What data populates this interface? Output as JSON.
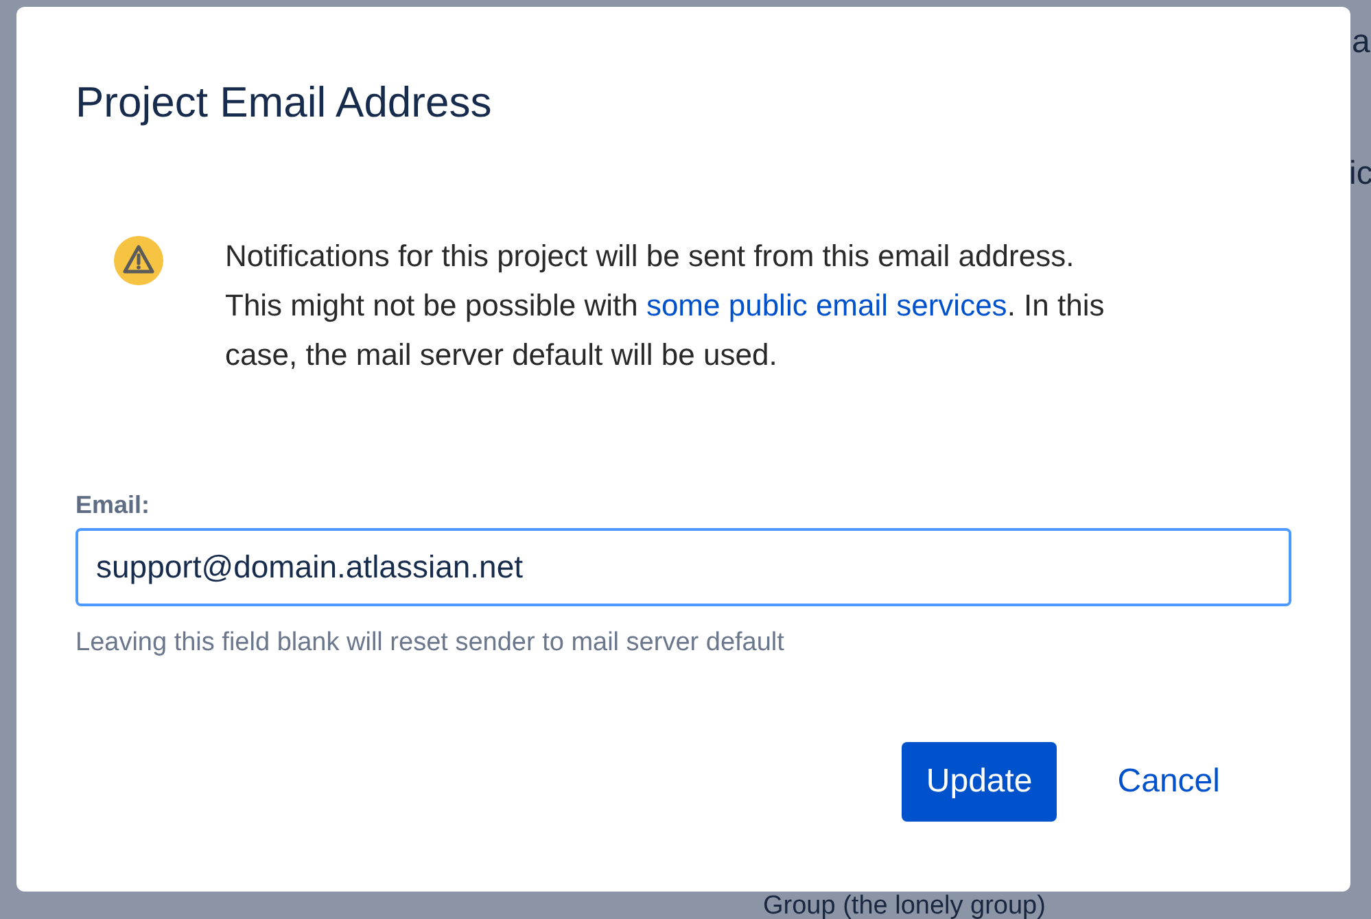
{
  "background": {
    "fragments": [
      {
        "text": "a"
      },
      {
        "text": "ic"
      },
      {
        "text": "Group (the lonely group)"
      }
    ]
  },
  "dialog": {
    "title": "Project Email Address",
    "notice": {
      "before": "Notifications for this project will be sent from this email address. This might not be possible with ",
      "link": "some public email services",
      "after": ". In this case, the mail server default will be used."
    },
    "email": {
      "label": "Email:",
      "value": "support@domain.atlassian.net",
      "focused": true,
      "help": "Leaving this field blank will reset sender to mail server default"
    },
    "buttons": [
      {
        "label": "Update",
        "kind": "primary"
      },
      {
        "label": "Cancel",
        "kind": "link"
      }
    ]
  }
}
